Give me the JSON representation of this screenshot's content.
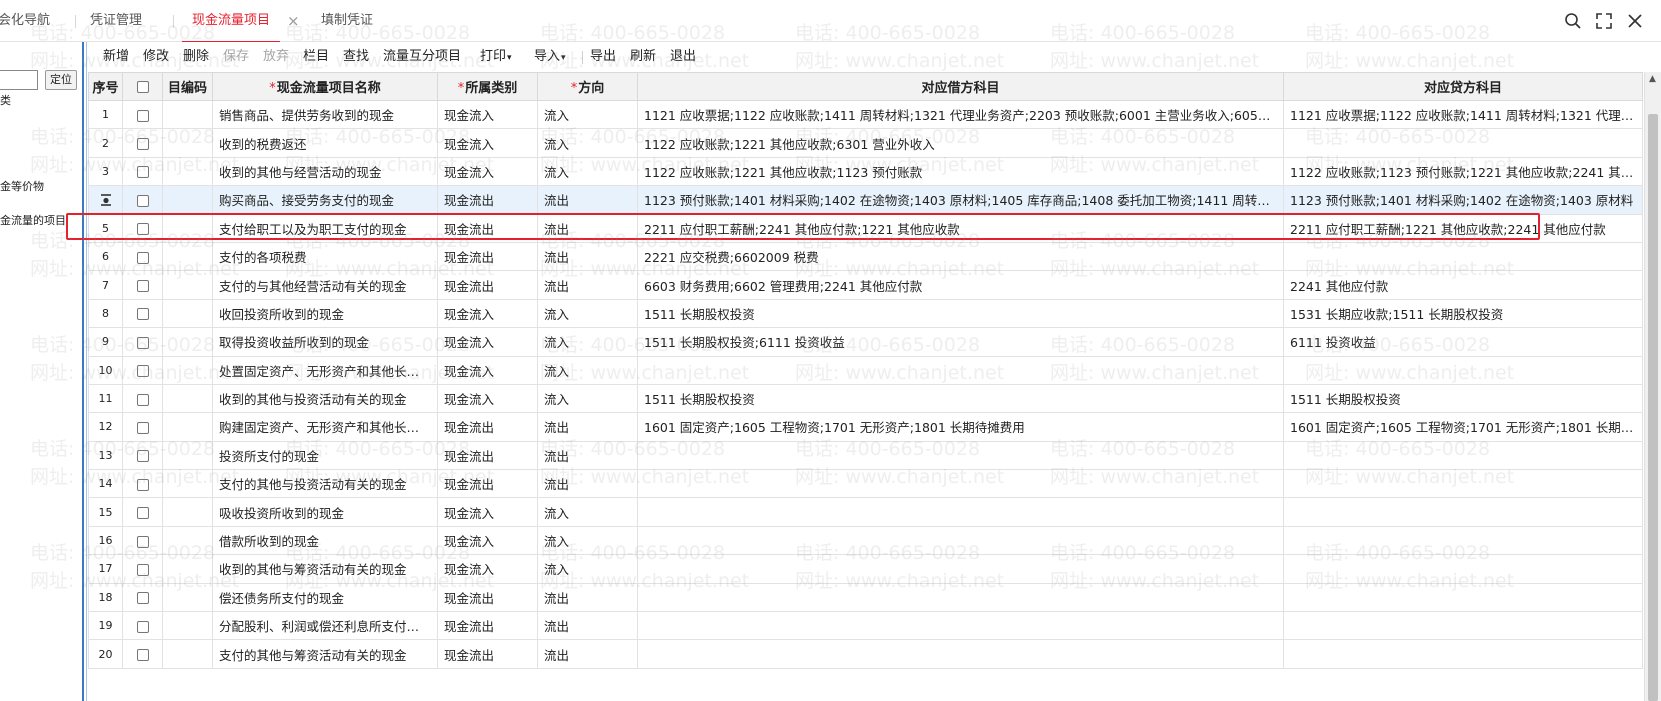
{
  "tabs": {
    "nav": "会化导航",
    "voucher_mgmt": "凭证管理",
    "cashflow": "现金流量项目",
    "fill_voucher": "填制凭证"
  },
  "left_panel": {
    "locate_btn": "定位",
    "items": [
      "类",
      "金等价物",
      "金流量的项目"
    ]
  },
  "toolbar": {
    "add": "新增",
    "modify": "修改",
    "delete": "删除",
    "save": "保存",
    "abandon": "放弃",
    "columns": "栏目",
    "find": "查找",
    "mutual": "流量互分项目",
    "print": "打印",
    "import": "导入",
    "export": "导出",
    "refresh": "刷新",
    "exit": "退出"
  },
  "columns": {
    "seq": "序号",
    "code": "目编码",
    "name": "现金流量项目名称",
    "category": "所属类别",
    "direction": "方向",
    "debit": "对应借方科目",
    "credit": "对应贷方科目"
  },
  "rows": [
    {
      "seq": "1",
      "name": "销售商品、提供劳务收到的现金",
      "category": "现金流入",
      "direction": "流入",
      "debit": "1121 应收票据;1122 应收账款;1411 周转材料;1321 代理业务资产;2203 预收账款;6001 主营业务收入;6051 其他业务收入",
      "credit": "1121 应收票据;1122 应收账款;1411 周转材料;1321 代理业务资产"
    },
    {
      "seq": "2",
      "name": "收到的税费返还",
      "category": "现金流入",
      "direction": "流入",
      "debit": "1122 应收账款;1221 其他应收款;6301 营业外收入",
      "credit": ""
    },
    {
      "seq": "3",
      "name": "收到的其他与经营活动的现金",
      "category": "现金流入",
      "direction": "流入",
      "debit": "1122 应收账款;1221 其他应收款;1123 预付账款",
      "credit": "1122 应收账款;1123 预付账款;1221 其他应收款;2241 其他应付款"
    },
    {
      "seq": "",
      "name": "购买商品、接受劳务支付的现金",
      "category": "现金流出",
      "direction": "流出",
      "debit": "1123 预付账款;1401 材料采购;1402 在途物资;1403 原材料;1405 库存商品;1408 委托加工物资;1411 周转材料",
      "credit": "1123 预付账款;1401 材料采购;1402 在途物资;1403 原材料"
    },
    {
      "seq": "5",
      "name": "支付给职工以及为职工支付的现金",
      "category": "现金流出",
      "direction": "流出",
      "debit": "2211 应付职工薪酬;2241 其他应付款;1221 其他应收款",
      "credit": "2211 应付职工薪酬;1221 其他应收款;2241 其他应付款"
    },
    {
      "seq": "6",
      "name": "支付的各项税费",
      "category": "现金流出",
      "direction": "流出",
      "debit": "2221 应交税费;6602009 税费",
      "credit": ""
    },
    {
      "seq": "7",
      "name": "支付的与其他经营活动有关的现金",
      "category": "现金流出",
      "direction": "流出",
      "debit": "6603 财务费用;6602 管理费用;2241 其他应付款",
      "credit": "2241 其他应付款"
    },
    {
      "seq": "8",
      "name": "收回投资所收到的现金",
      "category": "现金流入",
      "direction": "流入",
      "debit": "1511 长期股权投资",
      "credit": "1531 长期应收款;1511 长期股权投资"
    },
    {
      "seq": "9",
      "name": "取得投资收益所收到的现金",
      "category": "现金流入",
      "direction": "流入",
      "debit": "1511 长期股权投资;6111 投资收益",
      "credit": "6111 投资收益"
    },
    {
      "seq": "10",
      "name": "处置固定资产、无形资产和其他长期资产所收回的现金净额",
      "category": "现金流入",
      "direction": "流入",
      "debit": "",
      "credit": ""
    },
    {
      "seq": "11",
      "name": "收到的其他与投资活动有关的现金",
      "category": "现金流入",
      "direction": "流入",
      "debit": "1511 长期股权投资",
      "credit": "1511 长期股权投资"
    },
    {
      "seq": "12",
      "name": "购建固定资产、无形资产和其他长期资产所支付的现金",
      "category": "现金流出",
      "direction": "流出",
      "debit": "1601 固定资产;1605 工程物资;1701 无形资产;1801 长期待摊费用",
      "credit": "1601 固定资产;1605 工程物资;1701 无形资产;1801 长期待摊费用"
    },
    {
      "seq": "13",
      "name": "投资所支付的现金",
      "category": "现金流出",
      "direction": "流出",
      "debit": "",
      "credit": ""
    },
    {
      "seq": "14",
      "name": "支付的其他与投资活动有关的现金",
      "category": "现金流出",
      "direction": "流出",
      "debit": "",
      "credit": ""
    },
    {
      "seq": "15",
      "name": "吸收投资所收到的现金",
      "category": "现金流入",
      "direction": "流入",
      "debit": "",
      "credit": ""
    },
    {
      "seq": "16",
      "name": "借款所收到的现金",
      "category": "现金流入",
      "direction": "流入",
      "debit": "",
      "credit": ""
    },
    {
      "seq": "17",
      "name": "收到的其他与筹资活动有关的现金",
      "category": "现金流入",
      "direction": "流入",
      "debit": "",
      "credit": ""
    },
    {
      "seq": "18",
      "name": "偿还债务所支付的现金",
      "category": "现金流出",
      "direction": "流出",
      "debit": "",
      "credit": ""
    },
    {
      "seq": "19",
      "name": "分配股利、利润或偿还利息所支付的现金",
      "category": "现金流出",
      "direction": "流出",
      "debit": "",
      "credit": ""
    },
    {
      "seq": "20",
      "name": "支付的其他与筹资活动有关的现金",
      "category": "现金流出",
      "direction": "流出",
      "debit": "",
      "credit": ""
    }
  ],
  "watermark": {
    "phone": "电话: 400-665-0028",
    "site": "网址: www.chanjet.net"
  },
  "colors": {
    "accent": "#e5212e",
    "header_bg": "#f2f2f2",
    "selected_row": "#e8f2fc",
    "splitter": "#3a79c4"
  }
}
